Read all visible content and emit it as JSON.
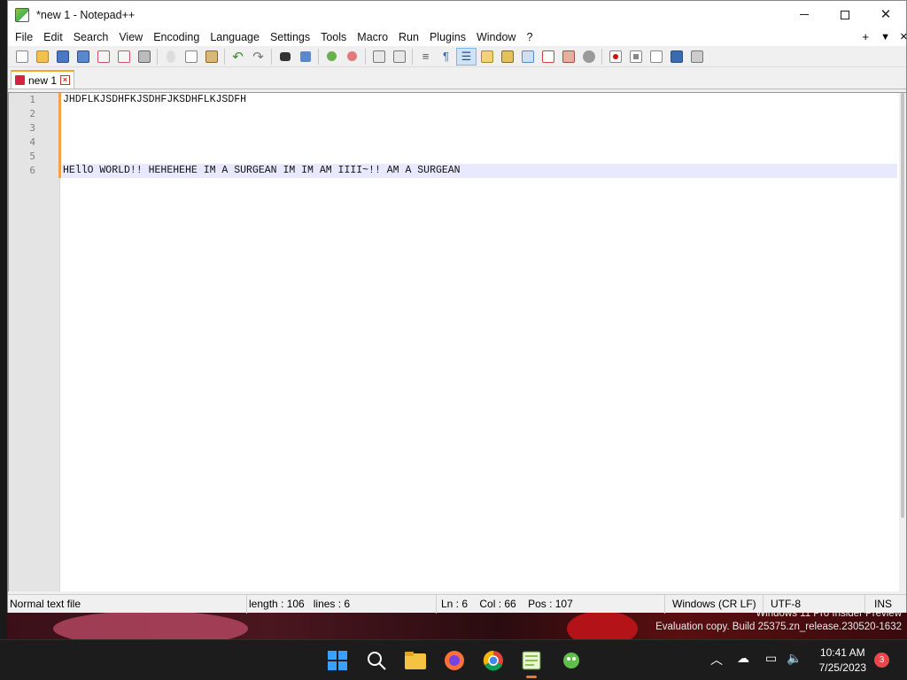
{
  "window": {
    "title": "*new 1 - Notepad++"
  },
  "menu": {
    "items": [
      "File",
      "Edit",
      "Search",
      "View",
      "Encoding",
      "Language",
      "Settings",
      "Tools",
      "Macro",
      "Run",
      "Plugins",
      "Window",
      "?"
    ],
    "right": [
      "+",
      "▼",
      "✕"
    ]
  },
  "tabs": [
    {
      "label": "new 1",
      "modified": true
    }
  ],
  "editor": {
    "lines": [
      {
        "number": "1",
        "text": "JHDFLKJSDHFKJSDHFJKSDHFLKJSDFH"
      },
      {
        "number": "2",
        "text": ""
      },
      {
        "number": "3",
        "text": ""
      },
      {
        "number": "4",
        "text": ""
      },
      {
        "number": "5",
        "text": ""
      },
      {
        "number": "6",
        "text": "HEllO WORLD!! HEHEHEHE IM A SURGEAN IM IM AM IIII~!! AM A SURGEAN"
      }
    ],
    "current_line": 6
  },
  "status": {
    "file_type": "Normal text file",
    "length": "length : 106",
    "lines": "lines : 6",
    "ln": "Ln : 6",
    "col": "Col : 66",
    "pos": "Pos : 107",
    "eol": "Windows (CR LF)",
    "encoding": "UTF-8",
    "mode": "INS"
  },
  "desktop_watermark": {
    "line1": "Windows 11 Pro Insider Preview",
    "line2": "Evaluation copy. Build 25375.zn_release.230520-1632"
  },
  "taskbar": {
    "apps": [
      "start-icon",
      "search-icon",
      "file-explorer-icon",
      "firefox-icon",
      "chrome-icon",
      "notepadpp-icon",
      "other-app-icon"
    ],
    "time": "10:41 AM",
    "date": "7/25/2023",
    "notification_count": "3"
  },
  "colors": {
    "accent_tab": "#f5a623",
    "current_line": "#e8e8ff",
    "changebar": "#f5a04a"
  }
}
